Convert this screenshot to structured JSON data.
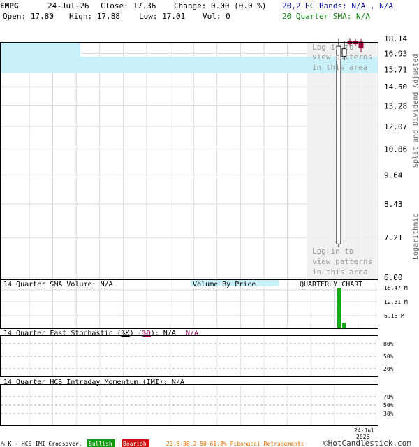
{
  "header": {
    "symbol": "EMPG",
    "date": "24-Jul-26",
    "close_label": "Close: 17.36",
    "change_label": "Change: 0.00 (0.0 %)",
    "open_label": "Open: 17.80",
    "high_label": "High: 17.88",
    "low_label": "Low: 17.01",
    "vol_label": "Vol: 0",
    "bands_label": "20,2 HC Bands: N/A , N/A",
    "sma_label": "20 Quarter SMA: N/A"
  },
  "side_labels": {
    "split": "Split and Dividend Adjusted",
    "scale": "Logarithmic"
  },
  "overlay_text": {
    "top": [
      "Log in to",
      "view patterns",
      "in this area"
    ],
    "bottom": [
      "Log in to",
      "view patterns",
      "in this area"
    ]
  },
  "volume_panel": {
    "sma_label": "14 Quarter SMA Volume: N/A",
    "vbp_label": "Volume By Price",
    "chart_label": "QUARTERLY CHART",
    "ticks": [
      "18.47 M",
      "12.31 M",
      "6.16 M"
    ]
  },
  "stoch_panel": {
    "prefix": "14 Quarter Fast Stochastic (",
    "k": "%K",
    "d": "%D",
    "suffix": "): N/A",
    "na2": "N/A",
    "ticks": [
      "80%",
      "50%",
      "20%"
    ]
  },
  "imi_panel": {
    "label": "14 Quarter HCS Intraday Momentum (IMI): N/A",
    "ticks": [
      "70%",
      "50%",
      "30%"
    ]
  },
  "footer": {
    "date_top": "24-Jul",
    "date_bottom": "2026",
    "legend_prefix": "% K - HCS IMI Crossover,",
    "bullish": "Bullish",
    "bearish": "Bearish",
    "fib": "23.6-38.2-50-61.8% Fibonacci Retracements",
    "copyright": "©HotCandlestick.com"
  },
  "colors": {
    "bullish": "#119911",
    "bearish": "#cc1111",
    "candle_down": "#990033",
    "band": "#c8f0f8",
    "volume": "#11aa11",
    "fib": "#e07000"
  },
  "chart_data": [
    {
      "type": "candlestick",
      "title": "EMPG",
      "scale": "log",
      "ylim": [
        6.0,
        18.14
      ],
      "yticks": [
        "18.14",
        "16.93",
        "15.71",
        "14.50",
        "13.28",
        "12.07",
        "10.86",
        "9.64",
        "8.43",
        "7.21",
        "6.00"
      ],
      "x": [
        "24-Jul-26"
      ],
      "candles": [
        {
          "open": 7.0,
          "high": 18.1,
          "low": 6.9,
          "close": 17.5,
          "color": "white"
        },
        {
          "open": 16.7,
          "high": 17.9,
          "low": 16.4,
          "close": 17.3,
          "color": "white"
        },
        {
          "open": 17.9,
          "high": 18.14,
          "low": 17.5,
          "close": 17.7,
          "color": "down"
        },
        {
          "open": 17.9,
          "high": 18.1,
          "low": 17.5,
          "close": 17.7,
          "color": "down"
        },
        {
          "open": 17.85,
          "high": 18.1,
          "low": 17.4,
          "close": 17.6,
          "color": "down"
        },
        {
          "open": 17.8,
          "high": 17.88,
          "low": 17.01,
          "close": 17.36,
          "color": "down"
        }
      ]
    },
    {
      "type": "bar",
      "title": "Volume",
      "ylim": [
        0,
        18.47
      ],
      "unit": "M",
      "values": [
        18.3,
        2.4
      ]
    }
  ]
}
